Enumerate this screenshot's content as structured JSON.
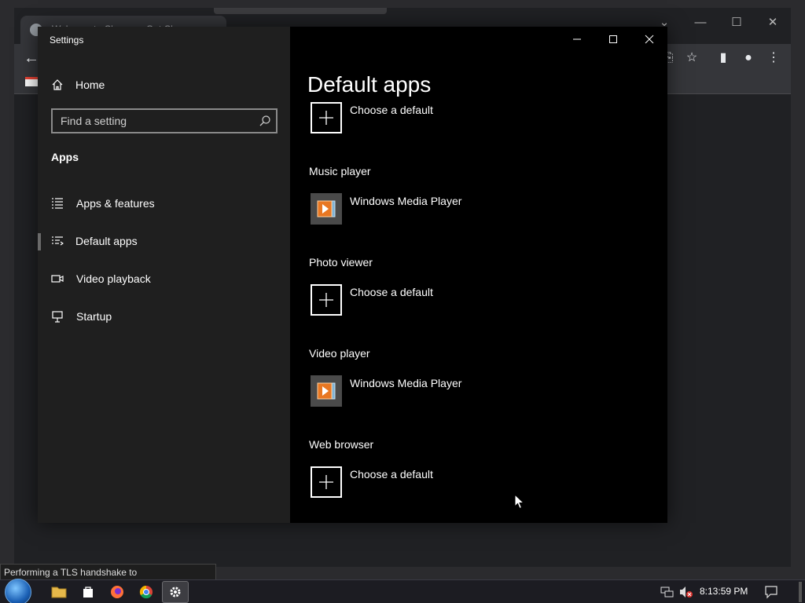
{
  "browser": {
    "tab_title": "Welcome to Chrome - Get Chrome...",
    "status_text": "Performing a TLS handshake to www.mozilla.org..."
  },
  "settings": {
    "window_title": "Settings",
    "home_label": "Home",
    "search_placeholder": "Find a setting",
    "section_title": "Apps",
    "nav": [
      {
        "label": "Apps & features",
        "icon": "list-icon"
      },
      {
        "label": "Default apps",
        "icon": "default-apps-icon",
        "active": true
      },
      {
        "label": "Video playback",
        "icon": "video-icon"
      },
      {
        "label": "Startup",
        "icon": "startup-icon"
      }
    ],
    "page_title": "Default apps",
    "defaults": [
      {
        "category": "",
        "app": "Choose a default",
        "icon": "plus-icon"
      },
      {
        "category": "Music player",
        "app": "Windows Media Player",
        "icon": "wmp-icon"
      },
      {
        "category": "Photo viewer",
        "app": "Choose a default",
        "icon": "plus-icon"
      },
      {
        "category": "Video player",
        "app": "Windows Media Player",
        "icon": "wmp-icon"
      },
      {
        "category": "Web browser",
        "app": "Choose a default",
        "icon": "plus-icon"
      }
    ]
  },
  "taskbar": {
    "clock": "8:13:59 PM"
  }
}
